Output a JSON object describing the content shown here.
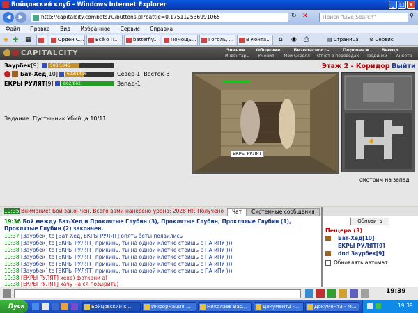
{
  "window": {
    "title": "Бойцовский клуб - Windows Internet Explorer"
  },
  "browser": {
    "url": "http://capitalcity.combats.ru/buttons.pl?battle=0.175112536991065",
    "search_placeholder": "Поиск \"Live Search\"",
    "menu": [
      "Файл",
      "Правка",
      "Вид",
      "Избранное",
      "Сервис",
      "Справка"
    ],
    "tabs": [
      "Орден С...",
      "Всё о П...",
      "batterfly...",
      "Помощь...",
      "Гоголь, ...",
      "В Конта..."
    ],
    "toolbar_right": [
      "Страница",
      "Сервис"
    ]
  },
  "game": {
    "logo": "CAPITALCITY",
    "nav": [
      "Знания",
      "Общение",
      "Безопасность",
      "Персонаж",
      "Выход"
    ],
    "subnav": [
      "Инвентарь",
      "Умения",
      "Мой Скролл",
      "Отчет о переводах",
      "Поединки",
      "Анкета"
    ],
    "location_title": "Этаж 2 - Коридор",
    "exit_label": "Выйти",
    "players": [
      {
        "name": "Заурбек",
        "level": "[9]",
        "hp": "503/1046",
        "hp_fraction": 0.48,
        "color": "#c89020"
      },
      {
        "name": "Бат-Хед",
        "level": "[10]",
        "hp": "603/1496",
        "hp_fraction": 0.4,
        "color": "#c89020",
        "coords": "Север-1, Восток-3"
      },
      {
        "name": "ЕКРЫ РУЛЯТ",
        "level": "[9]",
        "hp": "862/862",
        "hp_fraction": 1.0,
        "color": "#20a020",
        "coords": "Запад-1"
      }
    ],
    "task": "Задание: Пустынник Убийца 10/11",
    "scene_label": "ЕКРЫ РУЛЯТ",
    "look_direction": "смотрим на запад"
  },
  "chat": {
    "tabs": [
      "Чат",
      "Системные сообщения"
    ],
    "lines": [
      {
        "time": "19:35",
        "text": "Внимание! Бой закончен. Всего вами нанесено урона: 2028 HP. Получено"
      },
      {
        "time": "19:36",
        "text": "Бой между Бат-Хед и Проклятые Глубин (3), Проклятые Глубин, Проклятые Глубин (1),"
      },
      {
        "time": "",
        "text": "Проклятые Глубин (2) закончен."
      },
      {
        "time": "19:37",
        "text": "[Заурбек] to [Бат-Хед, ЕКРЫ РУЛЯТ] опять боты появились"
      },
      {
        "time": "19:38",
        "text": "[Заурбек] to [ЕКРЫ РУЛЯТ] прикинь, ты на одной клетке стоишь с ПА иПУ )))"
      },
      {
        "time": "19:38",
        "text": "[Заурбек] to [ЕКРЫ РУЛЯТ] прикинь, ты на одной клетке стоишь с ПА иПУ )))"
      },
      {
        "time": "19:38",
        "text": "[Заурбек] to [ЕКРЫ РУЛЯТ] прикинь, ты на одной клетке стоишь с ПА иПУ )))"
      },
      {
        "time": "19:38",
        "text": "[Заурбек] to [ЕКРЫ РУЛЯТ] прикинь, ты на одной клетке стоишь с ПА иПУ )))"
      },
      {
        "time": "19:38",
        "text": "[Заурбек] to [ЕКРЫ РУЛЯТ] прикинь, ты на одной клетке стоишь с ПА иПУ )))"
      },
      {
        "time": "19:38",
        "text": "[ЕКРЫ РУЛЯТ] хехе) фоткани а)"
      },
      {
        "time": "19:38",
        "text": "[ЕКРЫ РУЛЯТ] хачу на ся позырить)"
      }
    ]
  },
  "room": {
    "refresh_label": "Обновить",
    "title": "Пещера (3)",
    "members": [
      "Бат-Хед[10]",
      "ЕКРЫ РУЛЯТ[9]",
      "dnd Заурбек[9]"
    ],
    "auto_refresh_label": "Обновлять автомат."
  },
  "clock": "19:39",
  "taskbar": {
    "start": "Пуск",
    "items": [
      "Бойцовский к...",
      "Информация ...",
      "Николаев Вас...",
      "Документ2 -...",
      "Документ3 - М..."
    ],
    "time": "19:39"
  }
}
